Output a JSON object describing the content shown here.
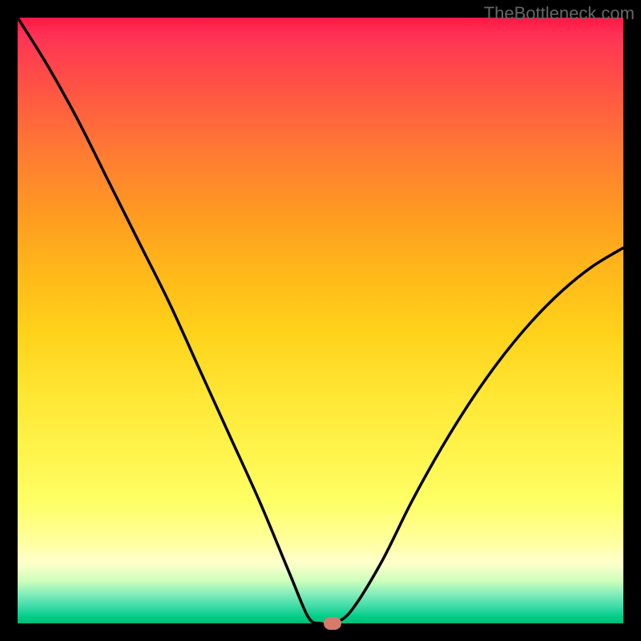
{
  "watermark": "TheBottleneck.com",
  "chart_data": {
    "type": "line",
    "title": "",
    "xlabel": "",
    "ylabel": "",
    "xlim": [
      0,
      100
    ],
    "ylim": [
      0,
      100
    ],
    "x": [
      0,
      5,
      10,
      15,
      20,
      25,
      30,
      35,
      40,
      45,
      48,
      50,
      52,
      55,
      60,
      65,
      70,
      75,
      80,
      85,
      90,
      95,
      100
    ],
    "values": [
      100,
      92,
      83,
      73,
      63,
      53,
      42,
      31,
      20,
      8,
      1,
      0,
      0,
      2,
      10,
      20,
      29,
      37,
      44,
      50,
      55,
      59,
      62
    ],
    "marker": {
      "x": 52,
      "y": 0
    },
    "gradient_colors": {
      "top": "#ff1744",
      "mid_upper": "#ff9922",
      "mid": "#ffe633",
      "mid_lower": "#ffffcc",
      "bottom": "#00bb77"
    }
  }
}
